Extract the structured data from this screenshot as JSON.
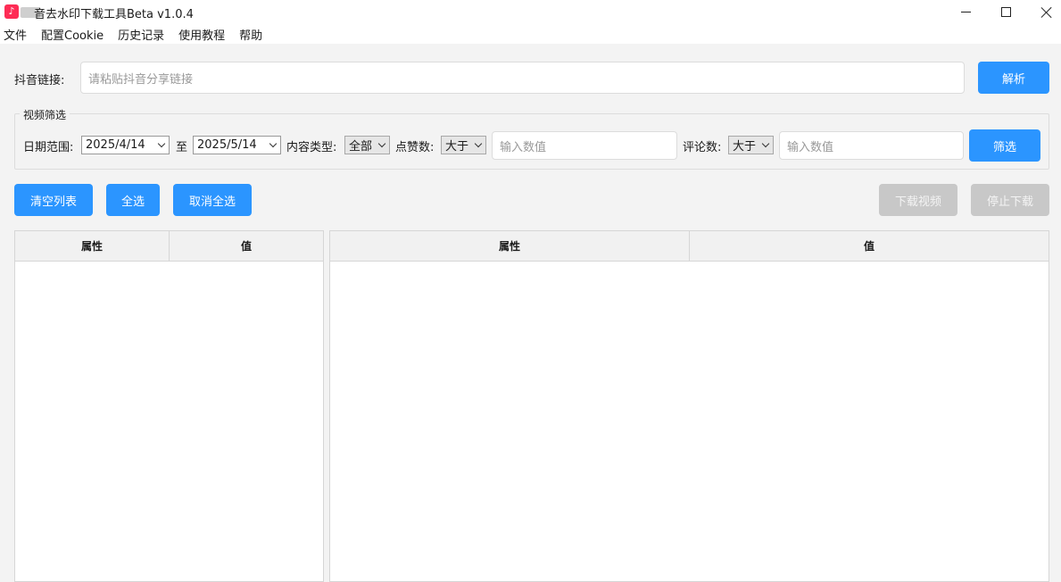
{
  "window": {
    "title": "音去水印下载工具Beta v1.0.4",
    "app_icon": "douyin-icon"
  },
  "menu": [
    "文件",
    "配置Cookie",
    "历史记录",
    "使用教程",
    "帮助"
  ],
  "url_row": {
    "label": "抖音链接:",
    "placeholder": "请粘贴抖音分享链接",
    "parse_button": "解析"
  },
  "filter": {
    "group_title": "视频筛选",
    "date_label": "日期范围:",
    "date_from": "2025/4/14",
    "date_to_label": "至",
    "date_to": "2025/5/14",
    "content_type_label": "内容类型:",
    "content_type_value": "全部",
    "likes_label": "点赞数:",
    "likes_op": "大于",
    "likes_placeholder": "输入数值",
    "comments_label": "评论数:",
    "comments_op": "大于",
    "comments_placeholder": "输入数值",
    "filter_button": "筛选"
  },
  "actions": {
    "clear_list": "清空列表",
    "select_all": "全选",
    "deselect_all": "取消全选",
    "download_video": "下载视频",
    "stop_download": "停止下载"
  },
  "left_table": {
    "columns": [
      "属性",
      "值"
    ]
  },
  "right_table": {
    "columns": [
      "属性",
      "值"
    ]
  },
  "colors": {
    "accent": "#2b95ff",
    "disabled": "#c8c8c8"
  }
}
